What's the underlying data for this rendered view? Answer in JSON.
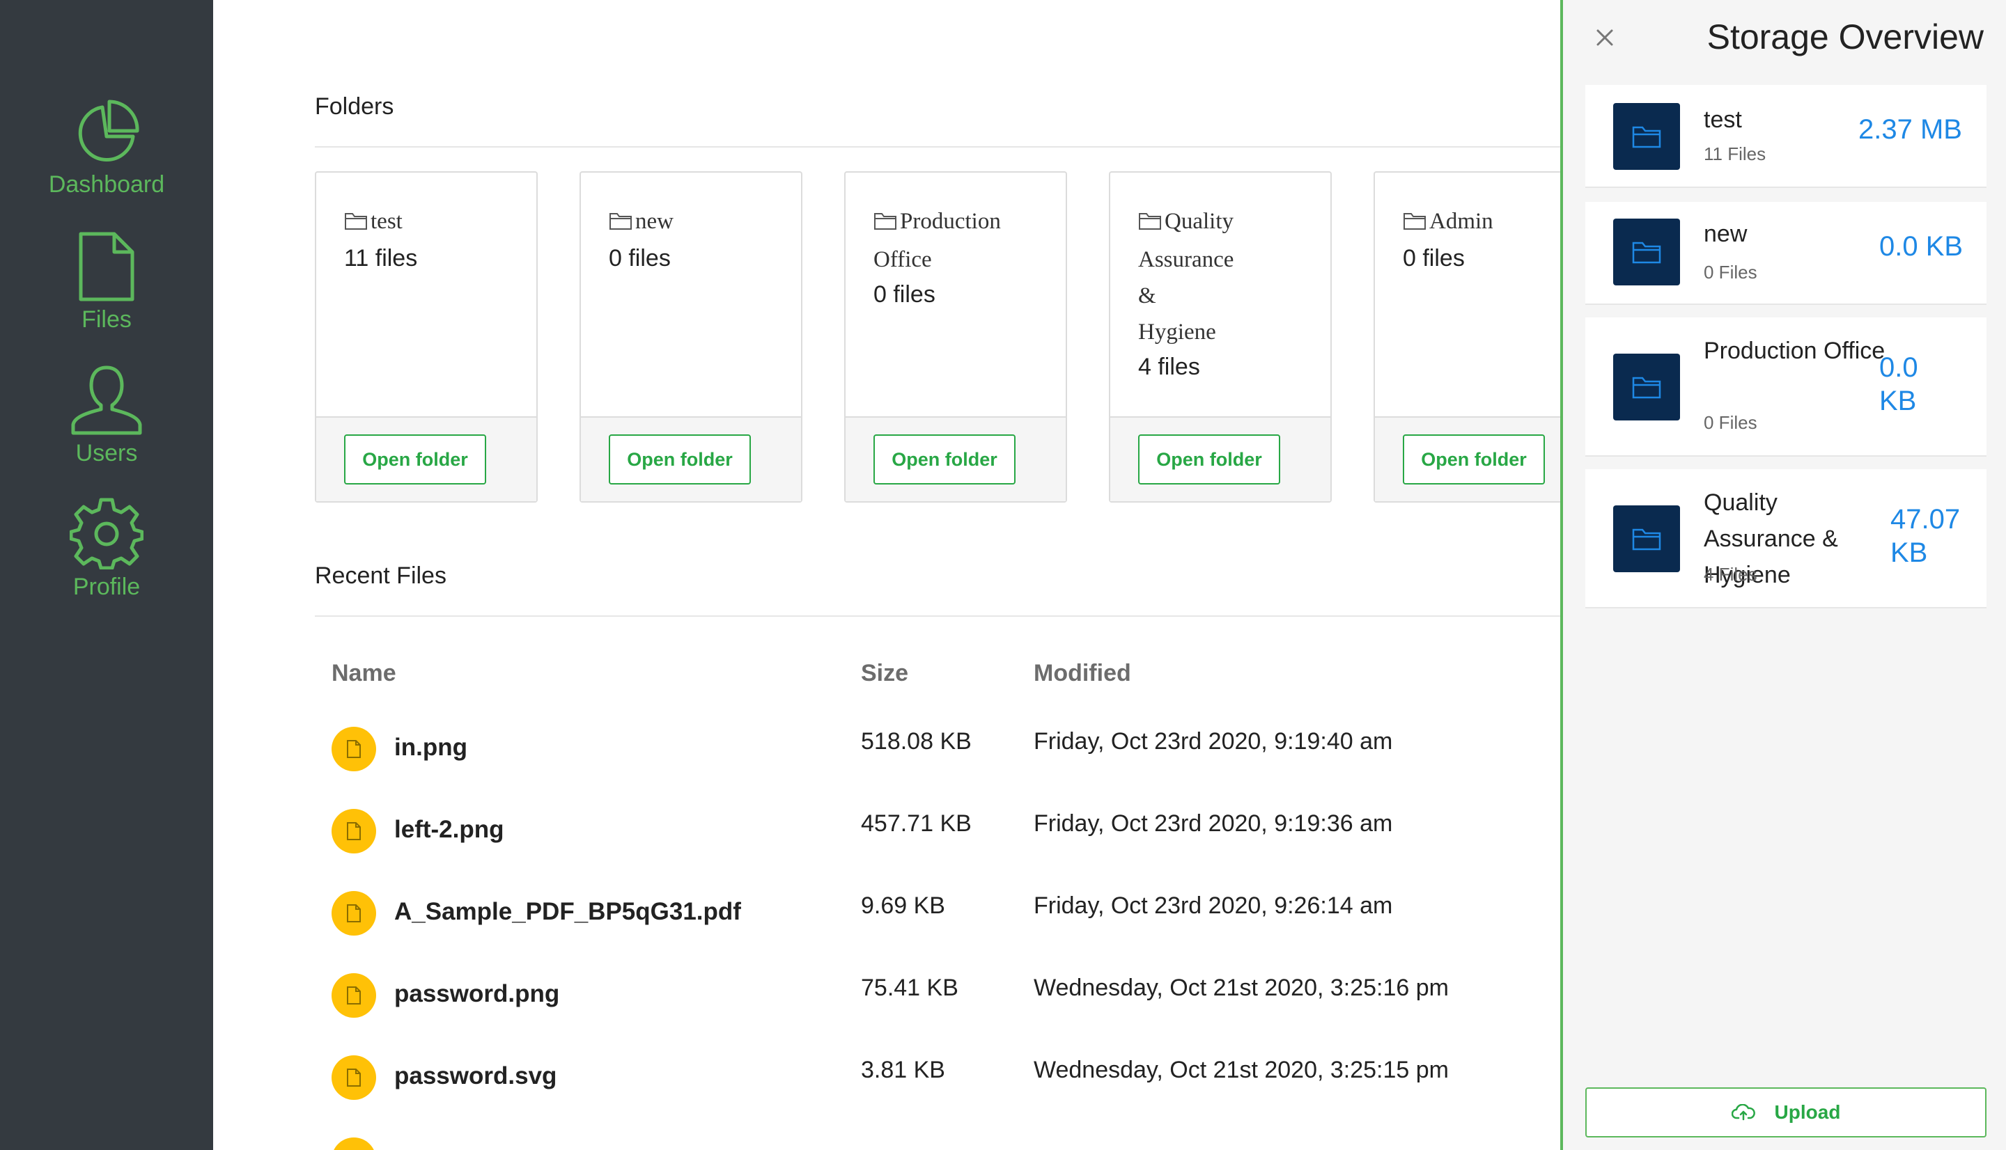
{
  "sidebar": {
    "items": [
      {
        "label": "Dashboard",
        "icon": "pie-chart-icon"
      },
      {
        "label": "Files",
        "icon": "file-icon"
      },
      {
        "label": "Users",
        "icon": "user-icon"
      },
      {
        "label": "Profile",
        "icon": "gear-icon"
      }
    ],
    "accent_color": "#5cb85c",
    "background": "#343a40"
  },
  "main": {
    "folders_title": "Folders",
    "recent_title": "Recent Files",
    "folders": [
      {
        "name_lines": [
          "test"
        ],
        "count": "11 files",
        "button": "Open folder"
      },
      {
        "name_lines": [
          "new"
        ],
        "count": "0 files",
        "button": "Open folder"
      },
      {
        "name_lines": [
          "Production",
          "Office"
        ],
        "count": "0 files",
        "button": "Open folder"
      },
      {
        "name_lines": [
          "Quality",
          "Assurance",
          "&",
          "Hygiene"
        ],
        "count": "4 files",
        "button": "Open folder"
      },
      {
        "name_lines": [
          "Admin"
        ],
        "count": "0 files",
        "button": "Open folder"
      }
    ],
    "table": {
      "headers": {
        "name": "Name",
        "size": "Size",
        "modified": "Modified"
      },
      "rows": [
        {
          "name": "in.png",
          "size": "518.08 KB",
          "modified": "Friday, Oct 23rd 2020, 9:19:40 am"
        },
        {
          "name": "left-2.png",
          "size": "457.71 KB",
          "modified": "Friday, Oct 23rd 2020, 9:19:36 am"
        },
        {
          "name": "A_Sample_PDF_BP5qG31.pdf",
          "size": "9.69 KB",
          "modified": "Friday, Oct 23rd 2020, 9:26:14 am"
        },
        {
          "name": "password.png",
          "size": "75.41 KB",
          "modified": "Wednesday, Oct 21st 2020, 3:25:16 pm"
        },
        {
          "name": "password.svg",
          "size": "3.81 KB",
          "modified": "Wednesday, Oct 21st 2020, 3:25:15 pm"
        }
      ]
    }
  },
  "panel": {
    "title": "Storage Overview",
    "items": [
      {
        "name": "test",
        "count": "11 Files",
        "size": "2.37 MB"
      },
      {
        "name": "new",
        "count": "0 Files",
        "size": "0.0 KB"
      },
      {
        "name": "Production Office",
        "count": "0 Files",
        "size": "0.0 KB"
      },
      {
        "name": "Quality Assurance & Hygiene",
        "count": "4 Files",
        "size": "47.07 KB"
      }
    ],
    "upload_label": "Upload",
    "accent_color": "#5cb85c",
    "size_color": "#1e88e5"
  }
}
